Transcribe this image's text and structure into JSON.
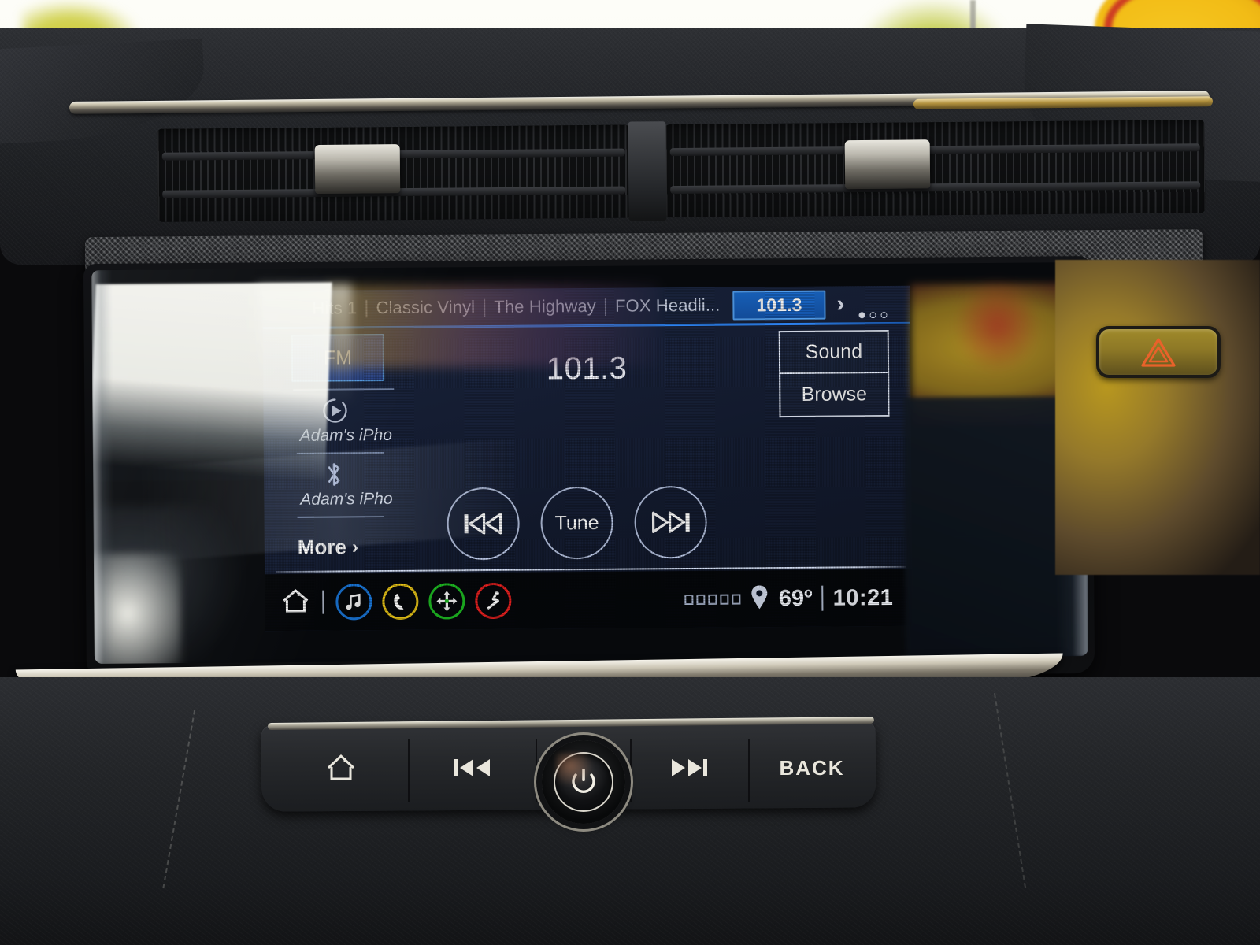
{
  "infotainment": {
    "presets": [
      {
        "label": "Hits 1",
        "selected": false
      },
      {
        "label": "Classic Vinyl",
        "selected": false
      },
      {
        "label": "The Highway",
        "selected": false
      },
      {
        "label": "FOX Headli...",
        "selected": false
      },
      {
        "label": "101.3",
        "selected": true
      }
    ],
    "next_page_icon": "chevron-right-icon",
    "page_dots": {
      "total": 3,
      "active_index": 0
    },
    "source": {
      "band_label": "FM",
      "carplay_icon": "play-circle-icon",
      "carplay_device": "Adam's iPho",
      "bluetooth_icon": "bluetooth-icon",
      "bluetooth_device": "Adam's iPho",
      "more_label": "More",
      "more_arrow": "chevron-right-icon"
    },
    "now_playing": {
      "frequency": "101.3"
    },
    "transport": {
      "previous_label": "previous-track-icon",
      "tune_label": "Tune",
      "next_label": "next-track-icon"
    },
    "side_buttons": [
      {
        "label": "Sound"
      },
      {
        "label": "Browse"
      }
    ],
    "status_bar": {
      "home_icon": "home-icon",
      "apps": [
        {
          "name": "media-app-icon",
          "glyph": "♫",
          "color": "#1a7ae0"
        },
        {
          "name": "phone-app-icon",
          "glyph": "✆",
          "color": "#e8c417"
        },
        {
          "name": "navigation-app-icon",
          "glyph": "✢",
          "color": "#1ec223"
        },
        {
          "name": "climate-seat-app-icon",
          "glyph": "↯",
          "color": "#e8201f"
        }
      ],
      "signal_bars": {
        "total": 5,
        "filled": 0
      },
      "location_icon": "location-pin-icon",
      "temperature": "69º",
      "clock": "10:21"
    },
    "colors": {
      "accent_blue": "#1b6fd6",
      "accent_blue_border": "#56a9ff",
      "screen_bg": "#1a2540",
      "text_primary": "#f4f7ff"
    }
  },
  "physical_controls": {
    "home_button": "home-icon",
    "previous_button": "previous-track-icon",
    "power_knob": "power-icon",
    "next_button": "next-track-icon",
    "back_button": "BACK"
  },
  "dashboard": {
    "hazard_button": "hazard-triangle-icon"
  }
}
